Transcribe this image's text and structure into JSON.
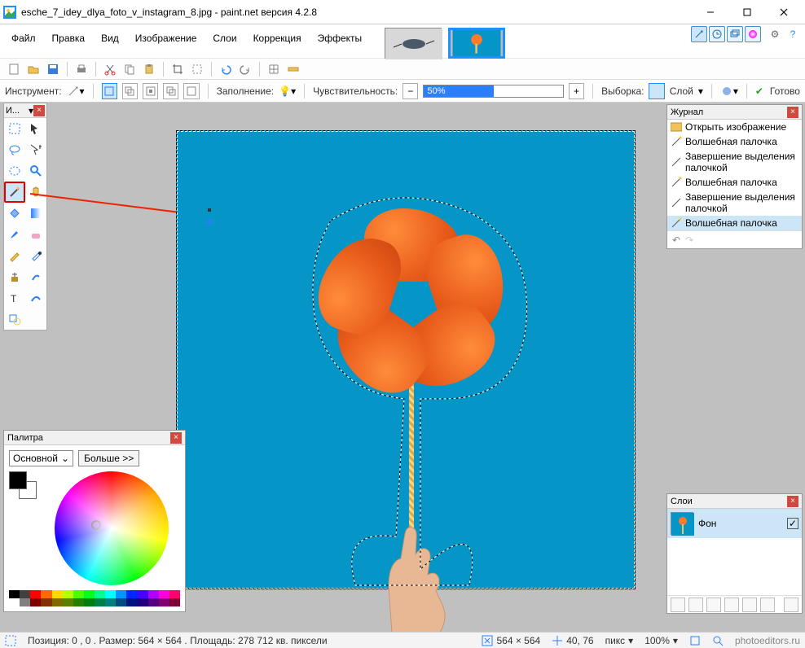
{
  "titlebar": {
    "title": "esche_7_idey_dlya_foto_v_instagram_8.jpg - paint.net версия 4.2.8"
  },
  "menus": [
    "Файл",
    "Правка",
    "Вид",
    "Изображение",
    "Слои",
    "Коррекция",
    "Эффекты"
  ],
  "toolopt": {
    "instrument_label": "Инструмент:",
    "fill_label": "Заполнение:",
    "tolerance_label": "Чувствительность:",
    "tolerance_value": "50%",
    "sampling_label": "Выборка:",
    "sampling_value": "Слой",
    "commit_label": "Готово"
  },
  "tools_panel": {
    "title": "И..."
  },
  "history": {
    "title": "Журнал",
    "items": [
      "Открыть изображение",
      "Волшебная палочка",
      "Завершение выделения палочкой",
      "Волшебная палочка",
      "Завершение выделения палочкой",
      "Волшебная палочка"
    ],
    "selected_index": 5
  },
  "layers": {
    "title": "Слои",
    "items": [
      {
        "name": "Фон",
        "visible": true
      }
    ]
  },
  "palette": {
    "title": "Палитра",
    "channel": "Основной",
    "more": "Больше >>"
  },
  "status": {
    "pos_size": "Позиция: 0 , 0 . Размер: 564  × 564 . Площадь: 278 712 кв. пиксели",
    "canvas": "564 × 564",
    "cursor": "40, 76",
    "units": "пикс",
    "zoom": "100%",
    "watermark": "photoeditors.ru"
  }
}
